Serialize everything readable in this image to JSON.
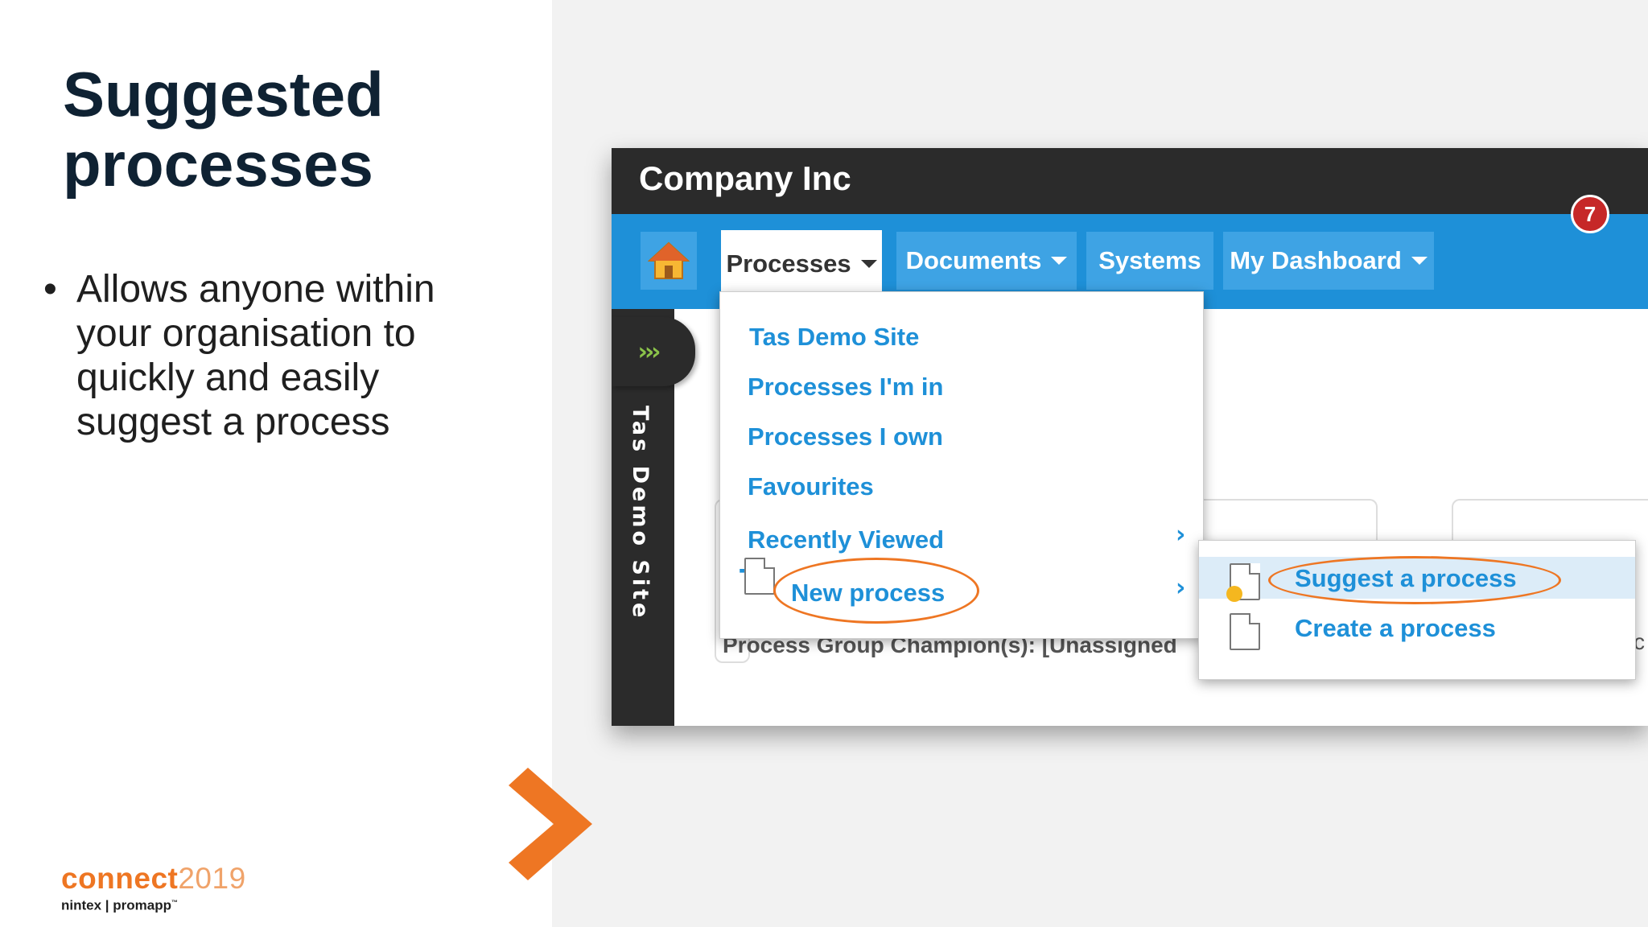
{
  "slide": {
    "title_line1": "Suggested",
    "title_line2": "processes",
    "bullets": [
      "Allows anyone within your organisation to quickly and easily suggest a process"
    ],
    "logo_word": "connect",
    "logo_year": "2019",
    "logo_sub": "nintex | promapp",
    "logo_tm": "™"
  },
  "app": {
    "company_name": "Company Inc",
    "nav": {
      "tabs": [
        "Processes",
        "Documents",
        "Systems",
        "My Dashboard"
      ],
      "notification_count": "7"
    },
    "side_rail_label": "Tas Demo Site",
    "champion_text": "Process Group Champion(s): [Unassigned",
    "champion_fragment": "c",
    "dropdown": {
      "items": [
        "Tas Demo Site",
        "Processes I'm in",
        "Processes I own",
        "Favourites",
        "Recently Viewed",
        "New process"
      ]
    },
    "submenu": {
      "items": [
        "Suggest a process",
        "Create a process"
      ]
    }
  },
  "colors": {
    "accent_orange": "#ee7623",
    "nav_blue": "#1e90d8",
    "tab_blue": "#3ea3e4",
    "dark_bar": "#2b2b2b",
    "badge_red": "#c62828",
    "title_navy": "#0f2233"
  },
  "icons": [
    "home-icon",
    "chevron-right-icon",
    "caret-down-icon",
    "plus-icon",
    "document-icon",
    "lightbulb-icon",
    "triple-chevron-icon"
  ]
}
